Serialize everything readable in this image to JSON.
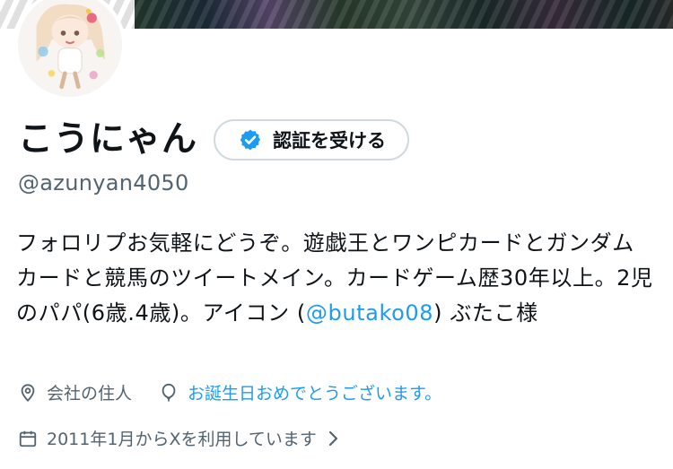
{
  "profile": {
    "display_name": "こうにゃん",
    "handle": "@azunyan4050",
    "verify_button_label": "認証を受ける",
    "bio_part1": "フォロリプお気軽にどうぞ。遊戯王とワンピカードとガンダムカードと競馬のツイートメイン。カードゲーム歴30年以上。2児のパパ(6歳.4歳)。アイコン (",
    "bio_mention": "@butako08",
    "bio_part2": ") ぶたこ様",
    "location": "会社の住人",
    "birthday_link": "お誕生日おめでとうございます。",
    "joined": "2011年1月からXを利用しています"
  },
  "icons": {
    "verify": "verified-badge-icon",
    "location": "location-pin-icon",
    "birthday": "balloon-icon",
    "joined": "calendar-icon",
    "more": "chevron-right-icon"
  },
  "colors": {
    "accent": "#1d9bf0",
    "secondary_text": "#536471",
    "border": "#cfd9de",
    "primary_text": "#0f1419"
  }
}
